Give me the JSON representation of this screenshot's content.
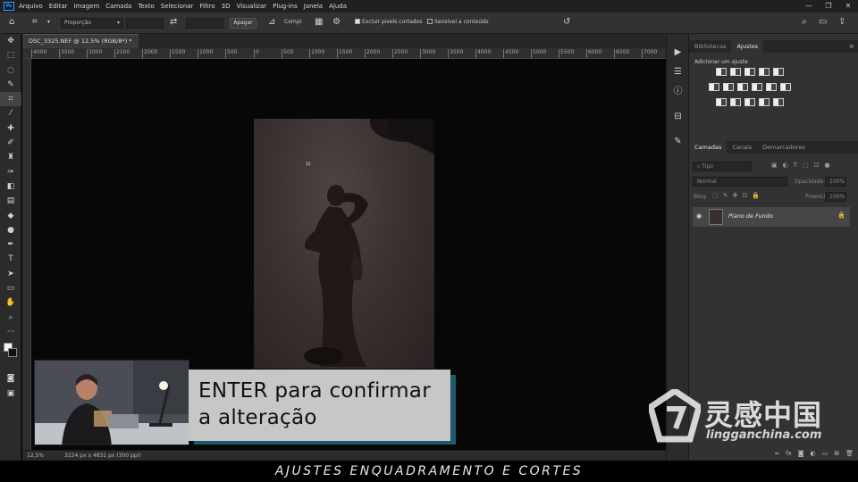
{
  "app": {
    "logo": "Ps"
  },
  "menu": [
    "Arquivo",
    "Editar",
    "Imagem",
    "Camada",
    "Texto",
    "Selecionar",
    "Filtro",
    "3D",
    "Visualizar",
    "Plug-ins",
    "Janela",
    "Ajuda"
  ],
  "options_bar": {
    "ratio_select": "Proporção",
    "clear_label": "Apagar",
    "straighten_label": "Compl",
    "delete_cropped": "Excluir pixels cortados",
    "content_aware": "Sensível a conteúdo"
  },
  "document": {
    "tab_title": "DSC_3325.NEF @ 12,5% (RGB/8*) *",
    "close": "×"
  },
  "ruler": [
    "4000",
    "3500",
    "3000",
    "2500",
    "2000",
    "1500",
    "1000",
    "500",
    "0",
    "500",
    "1000",
    "1500",
    "2000",
    "2500",
    "3000",
    "3500",
    "4000",
    "4500",
    "5000",
    "5500",
    "6000",
    "6500",
    "7000"
  ],
  "status": {
    "zoom": "12,5%",
    "dimensions": "3224 px x 4831 px (300 ppi)"
  },
  "panels": {
    "top_tabs": [
      "Bibliotecas",
      "Ajustes"
    ],
    "adjust_hint": "Adicionar um ajuste",
    "layer_tabs": [
      "Camadas",
      "Canais",
      "Demarcadores"
    ],
    "search_placeholder": "Tipo",
    "blend_mode": "Normal",
    "opacity_label": "Opacidade:",
    "opacity_value": "100%",
    "lock_label": "Bloq:",
    "fill_label": "Preench.:",
    "fill_value": "100%",
    "layer_name": "Plano de Fundo"
  },
  "caption": {
    "line1": "ENTER para confirmar",
    "line2": "a alteração"
  },
  "watermark": {
    "cn": "灵感中国",
    "url": "lingganchina.com"
  },
  "banner": "AJUSTES ENQUADRAMENTO E CORTES",
  "colors": {
    "accent": "#31a8ff",
    "caption_shadow": "#1f5a6a",
    "panel_bg": "#323232"
  }
}
